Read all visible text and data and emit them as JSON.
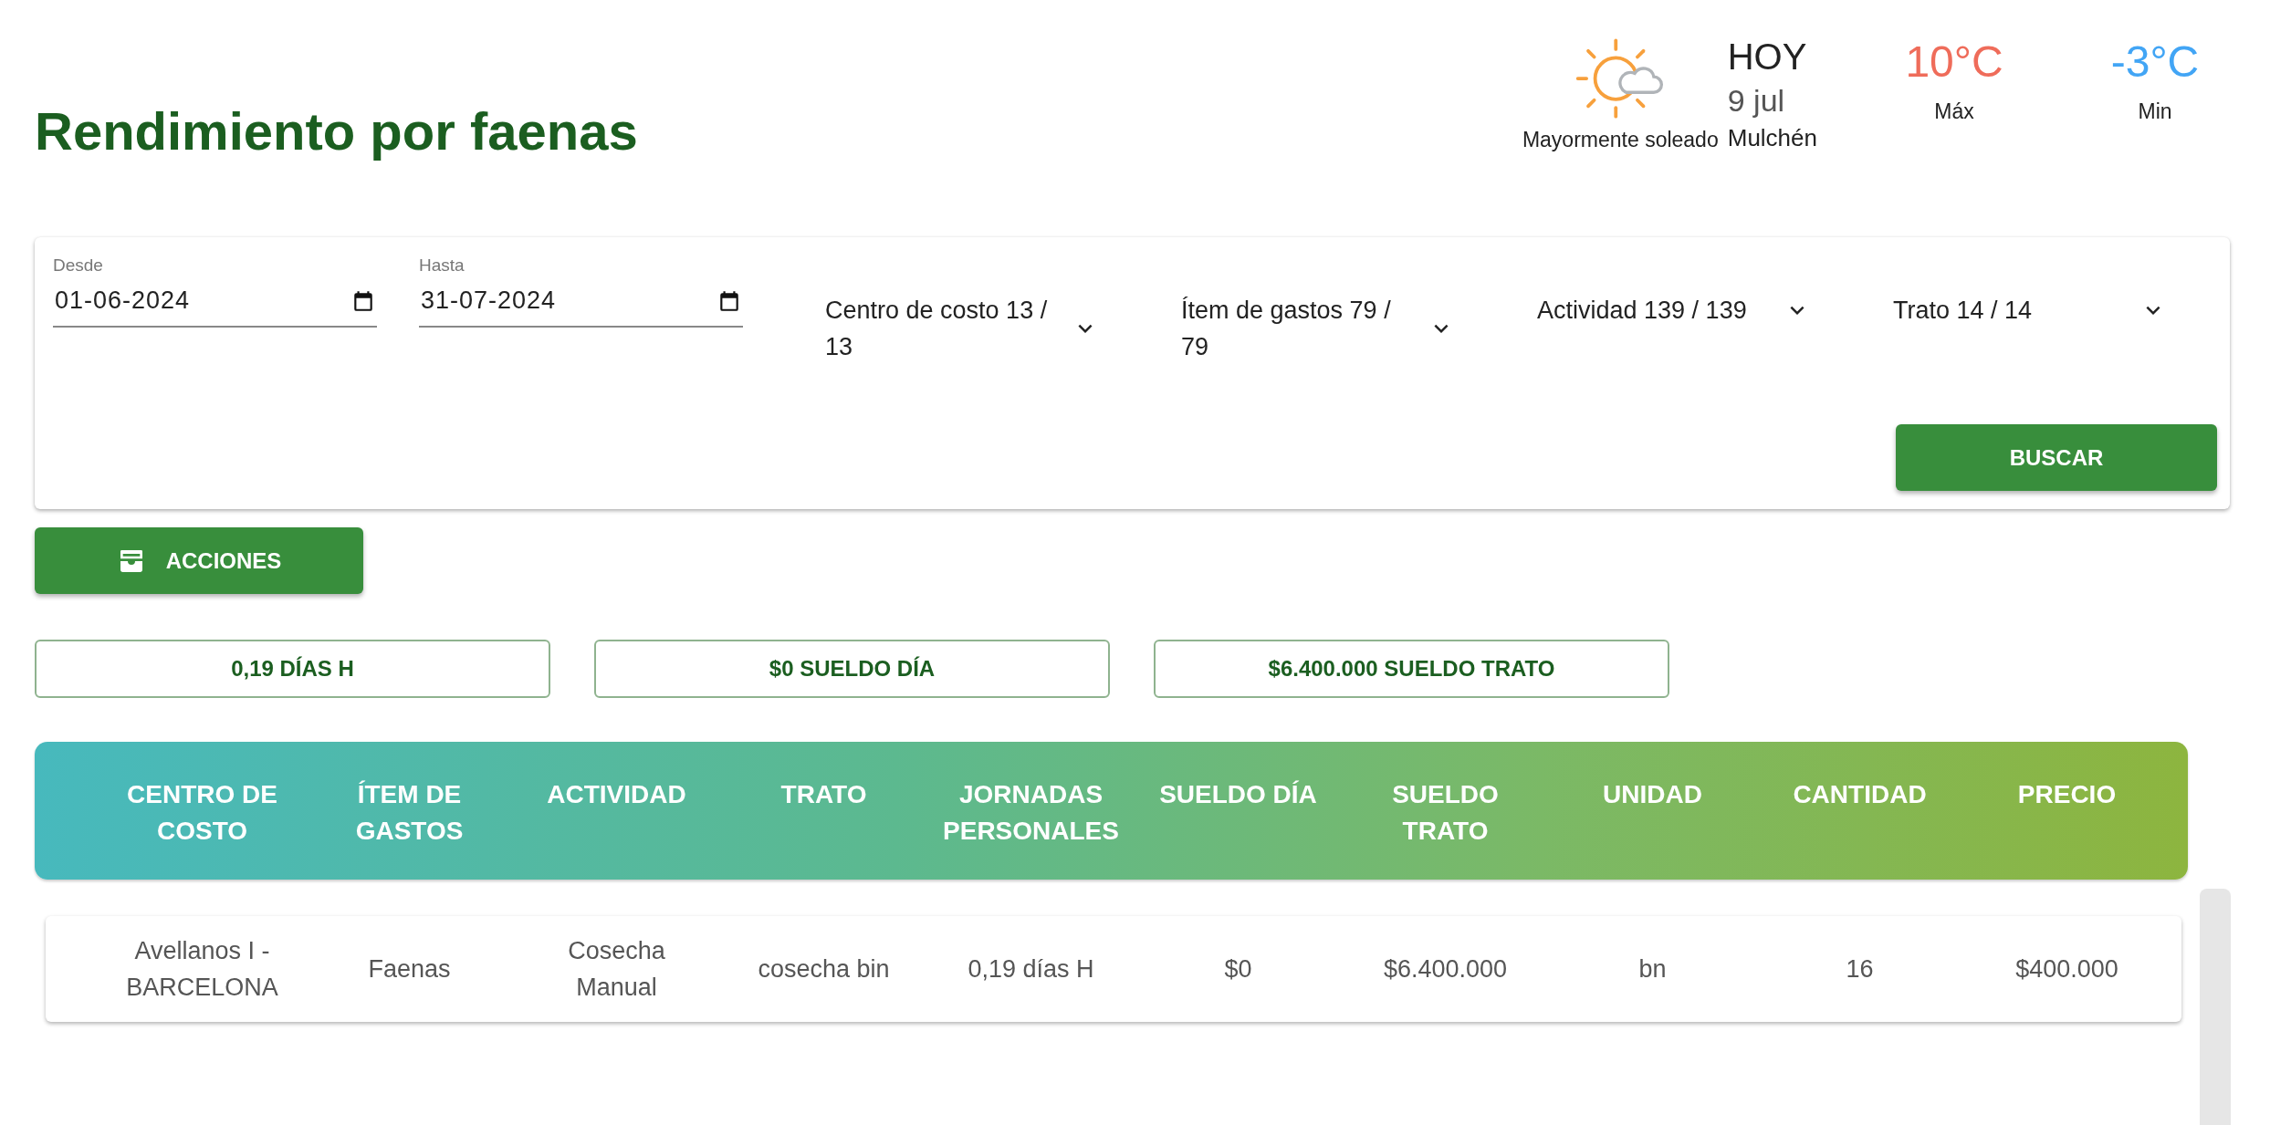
{
  "title": "Rendimiento por faenas",
  "weather": {
    "condition": "Mayormente soleado",
    "day": "HOY",
    "date": "9 jul",
    "place": "Mulchén",
    "max": {
      "value": "10°C",
      "label": "Máx"
    },
    "min": {
      "value": "-3°C",
      "label": "Min"
    }
  },
  "filters": {
    "dates": [
      {
        "label": "Desde",
        "value": "01-06-2024"
      },
      {
        "label": "Hasta",
        "value": "31-07-2024"
      }
    ],
    "selects": [
      "Centro de costo 13 / 13",
      "Ítem de gastos 79 / 79",
      "Actividad 139 / 139",
      "Trato 14 / 14"
    ],
    "search_button": "BUSCAR"
  },
  "actions_button": "ACCIONES",
  "summary": [
    "0,19 DÍAS H",
    "$0 SUELDO DÍA",
    "$6.400.000 SUELDO TRATO"
  ],
  "table": {
    "columns": [
      "CENTRO DE COSTO",
      "ÍTEM DE GASTOS",
      "ACTIVIDAD",
      "TRATO",
      "JORNADAS PERSONALES",
      "SUELDO DÍA",
      "SUELDO TRATO",
      "UNIDAD",
      "CANTIDAD",
      "PRECIO"
    ],
    "rows": [
      [
        "Avellanos I - BARCELONA",
        "Faenas",
        "Cosecha Manual",
        "cosecha bin",
        "0,19 días H",
        "$0",
        "$6.400.000",
        "bn",
        "16",
        "$400.000"
      ]
    ]
  }
}
